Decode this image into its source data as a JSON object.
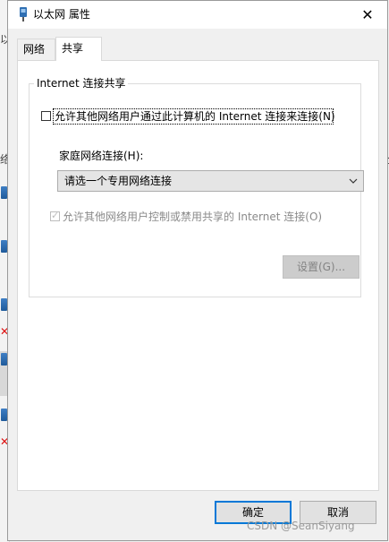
{
  "background": {
    "left_glyphs": [
      "以",
      "络",
      "l",
      "ɔ",
      "全"
    ]
  },
  "dialog": {
    "title": "以太网 属性",
    "close_label": "✕"
  },
  "tabs": [
    {
      "label": "网络",
      "active": false
    },
    {
      "label": "共享",
      "active": true
    }
  ],
  "sharing": {
    "group_title": "Internet 连接共享",
    "allow_share_label": "允许其他网络用户通过此计算机的 Internet 连接来连接(N)",
    "allow_share_checked": false,
    "home_network_label": "家庭网络连接(H):",
    "home_network_select": {
      "selected": "请选一个专用网络连接"
    },
    "allow_control_label": "允许其他网络用户控制或禁用共享的 Internet 连接(O)",
    "allow_control_checked": true,
    "allow_control_enabled": false,
    "settings_button": "设置(G)...",
    "settings_enabled": false
  },
  "footer": {
    "ok_label": "确定",
    "cancel_label": "取消"
  },
  "watermark": "CSDN @SeanSiyang"
}
